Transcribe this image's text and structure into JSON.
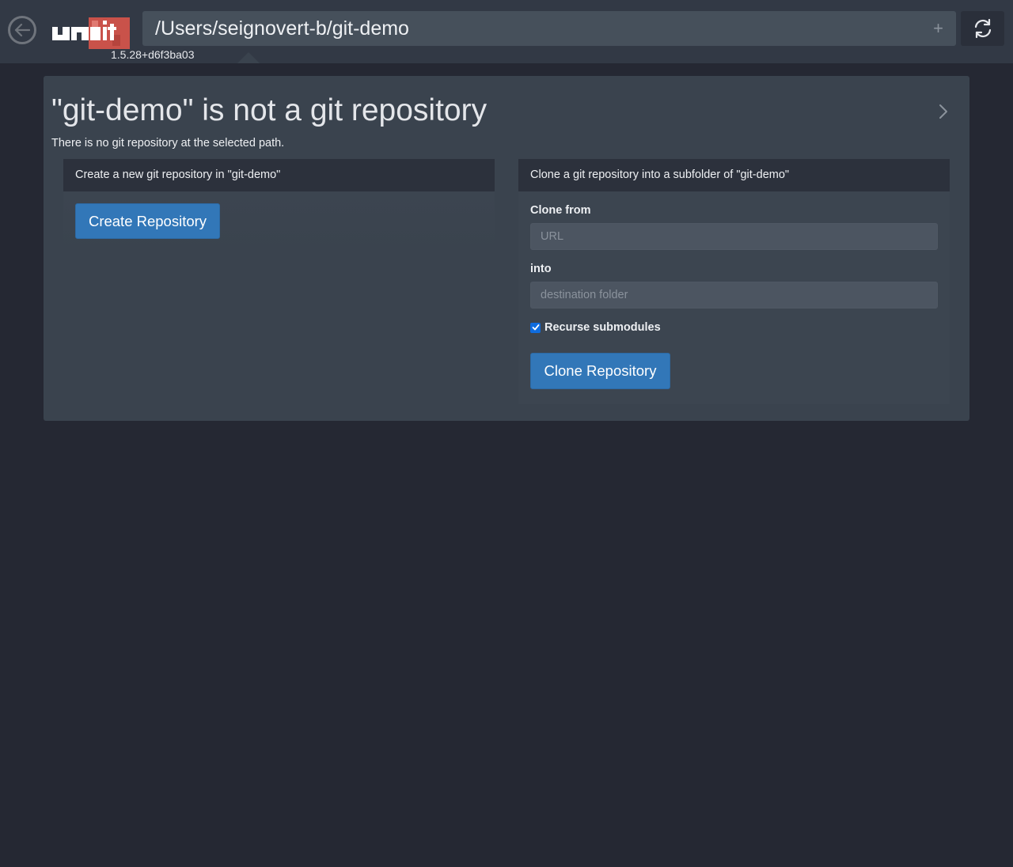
{
  "header": {
    "version": "1.5.28+d6f3ba03",
    "path_value": "/Users/seignovert-b/git-demo",
    "add_symbol": "+",
    "logo_text": "ungit"
  },
  "main": {
    "title": "\"git-demo\" is not a git repository",
    "subtitle": "There is no git repository at the selected path.",
    "create_card": {
      "header": "Create a new git repository in \"git-demo\"",
      "button": "Create Repository"
    },
    "clone_card": {
      "header": "Clone a git repository into a subfolder of \"git-demo\"",
      "clone_from_label": "Clone from",
      "url_placeholder": "URL",
      "into_label": "into",
      "destination_placeholder": "destination folder",
      "recurse_label": "Recurse submodules",
      "recurse_checked": true,
      "button": "Clone Repository"
    }
  },
  "colors": {
    "background": "#252833",
    "topbar": "#323945",
    "panel": "#3a434e",
    "primary": "#3277b8",
    "logo_red": "#c9524a"
  }
}
